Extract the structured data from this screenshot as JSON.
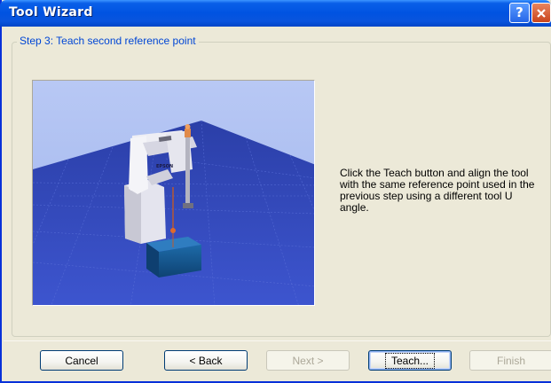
{
  "window": {
    "title": "Tool Wizard",
    "help_symbol": "?",
    "title_color": "#0053e1"
  },
  "step": {
    "title": "Step 3: Teach second reference point",
    "instruction": "Click the Teach button and align the tool with the same reference point used in the previous step using a different tool U angle."
  },
  "viewport": {
    "robot_logo": "EPSON"
  },
  "buttons": {
    "cancel": "Cancel",
    "back": "< Back",
    "next": "Next >",
    "teach": "Teach...",
    "finish": "Finish"
  },
  "states": {
    "next_enabled": false,
    "finish_enabled": false,
    "default_button": "teach"
  },
  "icons": {
    "help": "help-icon",
    "close": "close-icon"
  }
}
